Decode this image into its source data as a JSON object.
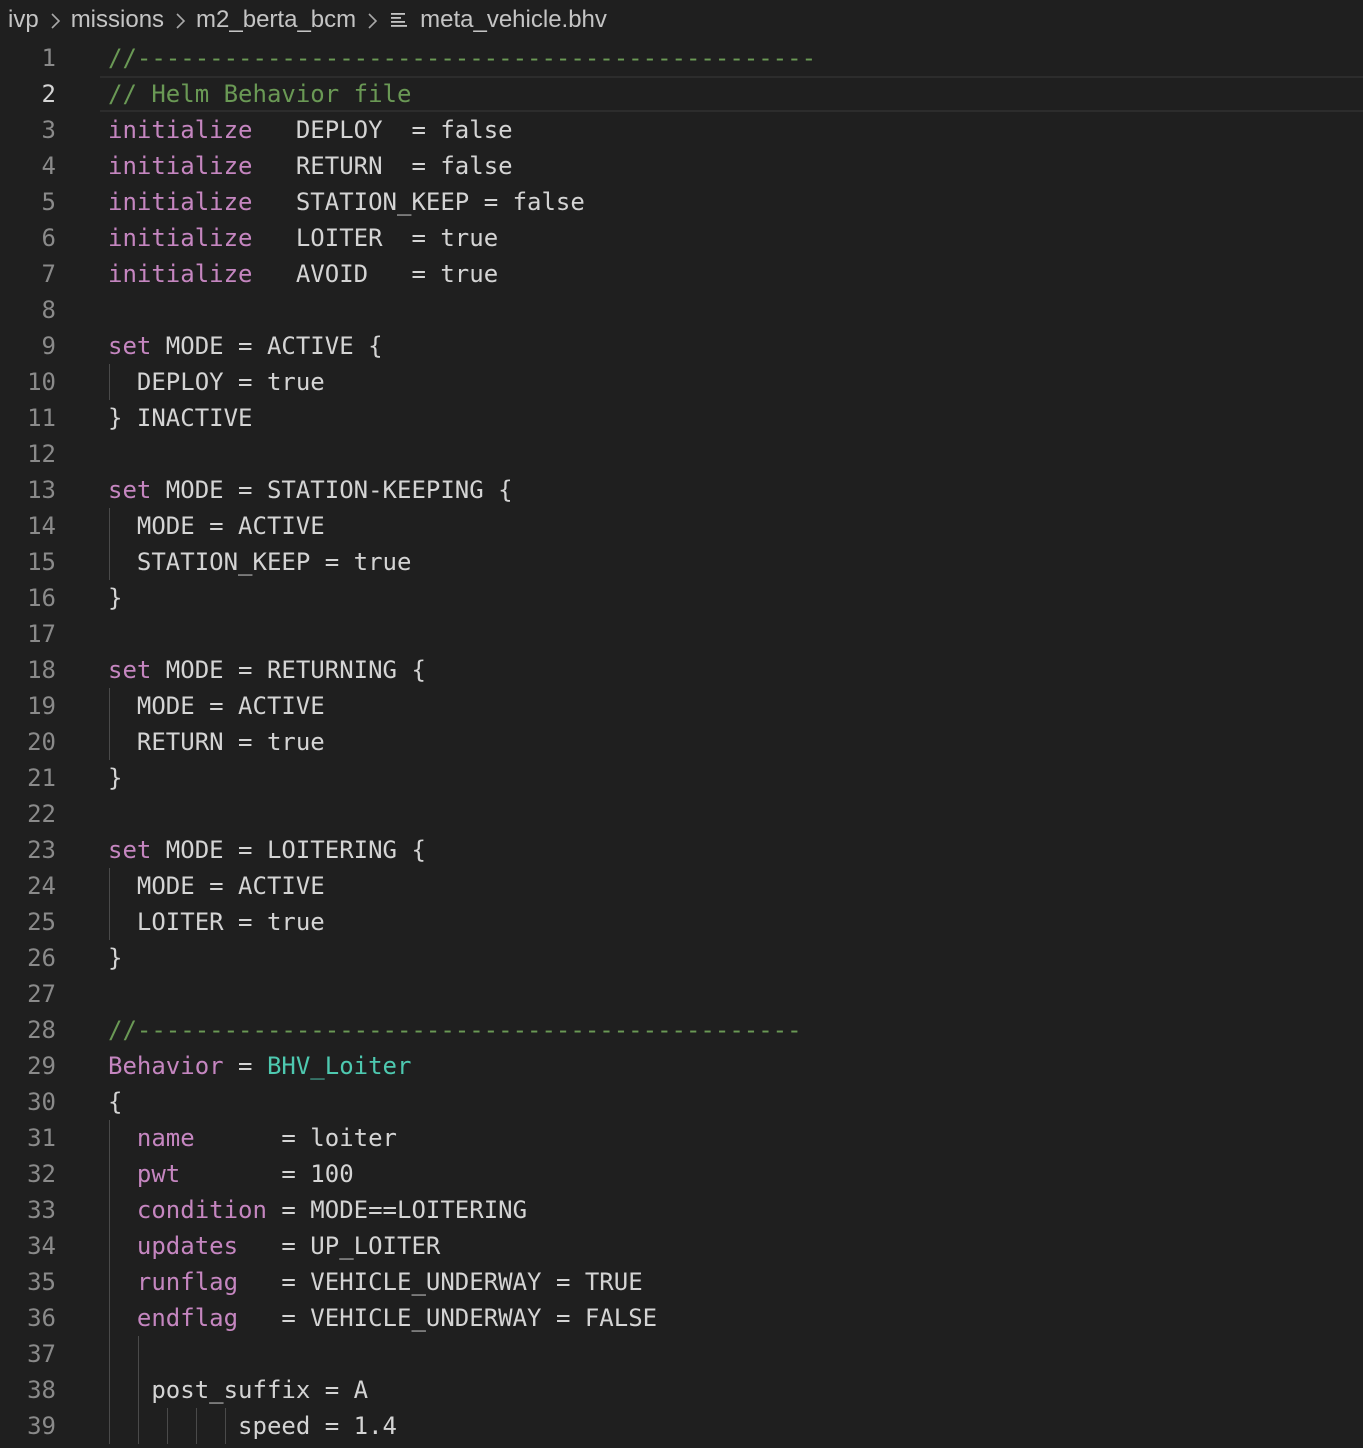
{
  "breadcrumb": {
    "items": [
      "ivp",
      "missions",
      "m2_berta_bcm"
    ],
    "file": "meta_vehicle.bhv"
  },
  "editor": {
    "current_line": 2,
    "lines": [
      {
        "n": "1",
        "tokens": [
          {
            "t": "//-----------------------------------------------",
            "c": "comment"
          }
        ]
      },
      {
        "n": "2",
        "tokens": [
          {
            "t": "// Helm Behavior file",
            "c": "comment"
          }
        ]
      },
      {
        "n": "3",
        "tokens": [
          {
            "t": "initialize",
            "c": "kw"
          },
          {
            "t": "   DEPLOY  = false",
            "c": "plain"
          }
        ]
      },
      {
        "n": "4",
        "tokens": [
          {
            "t": "initialize",
            "c": "kw"
          },
          {
            "t": "   RETURN  = false",
            "c": "plain"
          }
        ]
      },
      {
        "n": "5",
        "tokens": [
          {
            "t": "initialize",
            "c": "kw"
          },
          {
            "t": "   STATION_KEEP = false",
            "c": "plain"
          }
        ]
      },
      {
        "n": "6",
        "tokens": [
          {
            "t": "initialize",
            "c": "kw"
          },
          {
            "t": "   LOITER  = true",
            "c": "plain"
          }
        ]
      },
      {
        "n": "7",
        "tokens": [
          {
            "t": "initialize",
            "c": "kw"
          },
          {
            "t": "   AVOID   = true",
            "c": "plain"
          }
        ]
      },
      {
        "n": "8",
        "tokens": []
      },
      {
        "n": "9",
        "tokens": [
          {
            "t": "set",
            "c": "kw"
          },
          {
            "t": " MODE = ACTIVE {",
            "c": "plain"
          }
        ]
      },
      {
        "n": "10",
        "tokens": [
          {
            "t": "  DEPLOY = true",
            "c": "plain"
          }
        ]
      },
      {
        "n": "11",
        "tokens": [
          {
            "t": "} INACTIVE",
            "c": "plain"
          }
        ]
      },
      {
        "n": "12",
        "tokens": []
      },
      {
        "n": "13",
        "tokens": [
          {
            "t": "set",
            "c": "kw"
          },
          {
            "t": " MODE = STATION-KEEPING {",
            "c": "plain"
          }
        ]
      },
      {
        "n": "14",
        "tokens": [
          {
            "t": "  MODE = ACTIVE",
            "c": "plain"
          }
        ]
      },
      {
        "n": "15",
        "tokens": [
          {
            "t": "  STATION_KEEP = true",
            "c": "plain"
          }
        ]
      },
      {
        "n": "16",
        "tokens": [
          {
            "t": "}",
            "c": "plain"
          }
        ]
      },
      {
        "n": "17",
        "tokens": []
      },
      {
        "n": "18",
        "tokens": [
          {
            "t": "set",
            "c": "kw"
          },
          {
            "t": " MODE = RETURNING {",
            "c": "plain"
          }
        ]
      },
      {
        "n": "19",
        "tokens": [
          {
            "t": "  MODE = ACTIVE",
            "c": "plain"
          }
        ]
      },
      {
        "n": "20",
        "tokens": [
          {
            "t": "  RETURN = true",
            "c": "plain"
          }
        ]
      },
      {
        "n": "21",
        "tokens": [
          {
            "t": "}",
            "c": "plain"
          }
        ]
      },
      {
        "n": "22",
        "tokens": []
      },
      {
        "n": "23",
        "tokens": [
          {
            "t": "set",
            "c": "kw"
          },
          {
            "t": " MODE = LOITERING {",
            "c": "plain"
          }
        ]
      },
      {
        "n": "24",
        "tokens": [
          {
            "t": "  MODE = ACTIVE",
            "c": "plain"
          }
        ]
      },
      {
        "n": "25",
        "tokens": [
          {
            "t": "  LOITER = true",
            "c": "plain"
          }
        ]
      },
      {
        "n": "26",
        "tokens": [
          {
            "t": "}",
            "c": "plain"
          }
        ]
      },
      {
        "n": "27",
        "tokens": []
      },
      {
        "n": "28",
        "tokens": [
          {
            "t": "//----------------------------------------------",
            "c": "comment"
          }
        ]
      },
      {
        "n": "29",
        "tokens": [
          {
            "t": "Behavior",
            "c": "kw"
          },
          {
            "t": " = ",
            "c": "plain"
          },
          {
            "t": "BHV_Loiter",
            "c": "type"
          }
        ]
      },
      {
        "n": "30",
        "tokens": [
          {
            "t": "{",
            "c": "plain"
          }
        ]
      },
      {
        "n": "31",
        "tokens": [
          {
            "t": "  ",
            "c": "plain"
          },
          {
            "t": "name",
            "c": "param"
          },
          {
            "t": "      = loiter",
            "c": "plain"
          }
        ]
      },
      {
        "n": "32",
        "tokens": [
          {
            "t": "  ",
            "c": "plain"
          },
          {
            "t": "pwt",
            "c": "param"
          },
          {
            "t": "       = 100",
            "c": "plain"
          }
        ]
      },
      {
        "n": "33",
        "tokens": [
          {
            "t": "  ",
            "c": "plain"
          },
          {
            "t": "condition",
            "c": "param"
          },
          {
            "t": " = MODE==LOITERING",
            "c": "plain"
          }
        ]
      },
      {
        "n": "34",
        "tokens": [
          {
            "t": "  ",
            "c": "plain"
          },
          {
            "t": "updates",
            "c": "param"
          },
          {
            "t": "   = UP_LOITER",
            "c": "plain"
          }
        ]
      },
      {
        "n": "35",
        "tokens": [
          {
            "t": "  ",
            "c": "plain"
          },
          {
            "t": "runflag",
            "c": "param"
          },
          {
            "t": "   = VEHICLE_UNDERWAY = TRUE",
            "c": "plain"
          }
        ]
      },
      {
        "n": "36",
        "tokens": [
          {
            "t": "  ",
            "c": "plain"
          },
          {
            "t": "endflag",
            "c": "param"
          },
          {
            "t": "   = VEHICLE_UNDERWAY = FALSE",
            "c": "plain"
          }
        ]
      },
      {
        "n": "37",
        "tokens": []
      },
      {
        "n": "38",
        "tokens": [
          {
            "t": "   post_suffix = A",
            "c": "plain"
          }
        ]
      },
      {
        "n": "39",
        "tokens": [
          {
            "t": "         speed = 1.4",
            "c": "plain"
          }
        ]
      }
    ]
  }
}
